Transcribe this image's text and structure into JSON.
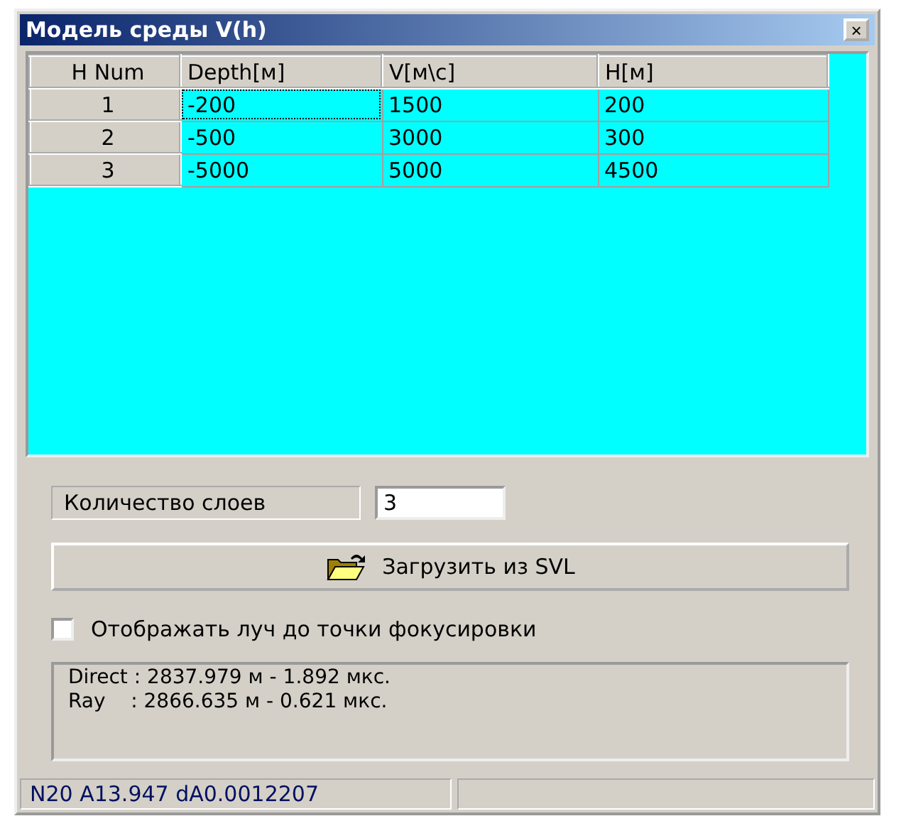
{
  "window": {
    "title": "Модель среды V(h)",
    "close": "×"
  },
  "table": {
    "columns": [
      "H Num",
      "Depth[м]",
      "V[м\\с]",
      "H[м]"
    ],
    "rows": [
      {
        "cells": [
          {
            "text": "1",
            "kind": "header",
            "focused": false
          },
          {
            "text": "-200",
            "kind": "data",
            "focused": true
          },
          {
            "text": "1500",
            "kind": "data",
            "focused": false
          },
          {
            "text": "200",
            "kind": "data",
            "focused": false
          }
        ]
      },
      {
        "cells": [
          {
            "text": "2",
            "kind": "header",
            "focused": false
          },
          {
            "text": "-500",
            "kind": "data",
            "focused": false
          },
          {
            "text": "3000",
            "kind": "data",
            "focused": false
          },
          {
            "text": "300",
            "kind": "data",
            "focused": false
          }
        ]
      },
      {
        "cells": [
          {
            "text": "3",
            "kind": "header",
            "focused": false
          },
          {
            "text": "-5000",
            "kind": "data",
            "focused": false
          },
          {
            "text": "5000",
            "kind": "data",
            "focused": false
          },
          {
            "text": "4500",
            "kind": "data",
            "focused": false
          }
        ]
      }
    ]
  },
  "layers": {
    "label": "Количество слоев",
    "value": "3"
  },
  "load_button": "Загрузить из SVL",
  "show_ray": {
    "label": "Отображать луч до точки фокусировки",
    "checked": false
  },
  "output": [
    "Direct : 2837.979 м - 1.892 мкс.",
    "Ray    : 2866.635 м - 0.621 мкс."
  ],
  "status_bar": {
    "text": "N20 A13.947 dA0.0012207"
  }
}
